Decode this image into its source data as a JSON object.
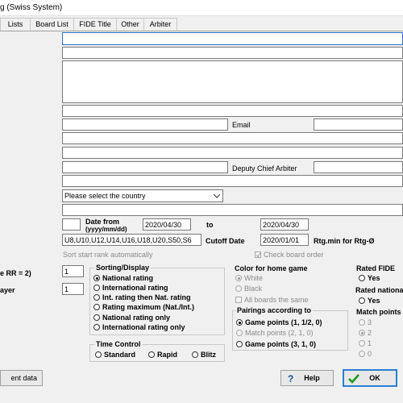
{
  "window": {
    "title": "g (Swiss System)"
  },
  "tabs": [
    "Lists",
    "Board List",
    "FIDE Title",
    "Other",
    "Arbiter"
  ],
  "labels": {
    "email": "Email",
    "deputy": "Deputy Chief Arbiter",
    "date_from": "Date from",
    "date_fmt": "(yyyy/mm/dd)",
    "to": "to",
    "cutoff": "Cutoff Date",
    "rtg_min": "Rtg.min for Rtg-Ø",
    "sort_auto": "Sort start rank automatically",
    "check_order": "Check board order",
    "left_rr": "e RR = 2)",
    "left_player": "ayer"
  },
  "fields": {
    "country": "Please select the country",
    "date_from": "2020/04/30",
    "date_to": "2020/04/30",
    "categories": "U8,U10,U12,U14,U16,U18,U20,S50,S6",
    "cutoff": "2020/01/01",
    "num1": "1",
    "num2": "1"
  },
  "sorting": {
    "title": "Sorting/Display",
    "options": [
      "National rating",
      "International rating",
      "Int. rating then Nat. rating",
      "Rating maximum (Nat./Int.)",
      "National rating only",
      "International rating only"
    ],
    "selected": 0
  },
  "color_home": {
    "title": "Color for home game",
    "options": [
      "White",
      "Black"
    ],
    "check": "All boards the same"
  },
  "pairings": {
    "title": "Pairings according to",
    "options": [
      "Game points (1, 1/2, 0)",
      "Match points (2, 1, 0)",
      "Game points (3, 1, 0)"
    ]
  },
  "rated_fide": {
    "title": "Rated FIDE",
    "yes": "Yes"
  },
  "rated_national": {
    "title": "Rated nationa",
    "yes": "Yes"
  },
  "match_points": {
    "title": "Match points",
    "options": [
      "3",
      "2",
      "1",
      "0"
    ]
  },
  "time_control": {
    "title": "Time Control",
    "options": [
      "Standard",
      "Rapid",
      "Blitz"
    ]
  },
  "buttons": {
    "left": "ent data",
    "help": "Help",
    "ok": "OK"
  },
  "colors": {
    "ok_border": "#2a7fd4",
    "help_icon": "#1a4fa0",
    "ok_check": "#1a9a1a"
  }
}
